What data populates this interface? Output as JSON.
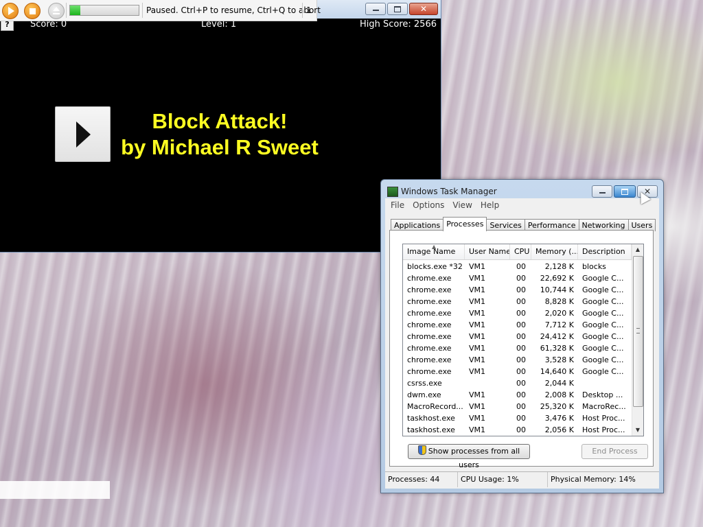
{
  "macro_bar": {
    "status_text": "Paused. Ctrl+P to resume, Ctrl+Q to abort",
    "counter": "1",
    "progress_percent": 15
  },
  "game": {
    "help_label": "?",
    "score_label": "Score: 0",
    "level_label": "Level: 1",
    "high_score_label": "High Score: 2566",
    "title_line1": "Block Attack!",
    "title_line2": "by Michael R Sweet",
    "title_color": "#ffff22"
  },
  "task_manager": {
    "title": "Windows Task Manager",
    "menu": [
      "File",
      "Options",
      "View",
      "Help"
    ],
    "tabs": [
      "Applications",
      "Processes",
      "Services",
      "Performance",
      "Networking",
      "Users"
    ],
    "active_tab": "Processes",
    "columns": [
      "Image Name",
      "User Name",
      "CPU",
      "Memory (...",
      "Description"
    ],
    "rows": [
      [
        "blocks.exe *32",
        "VM1",
        "00",
        "2,128 K",
        "blocks"
      ],
      [
        "chrome.exe",
        "VM1",
        "00",
        "22,692 K",
        "Google C..."
      ],
      [
        "chrome.exe",
        "VM1",
        "00",
        "10,744 K",
        "Google C..."
      ],
      [
        "chrome.exe",
        "VM1",
        "00",
        "8,828 K",
        "Google C..."
      ],
      [
        "chrome.exe",
        "VM1",
        "00",
        "2,020 K",
        "Google C..."
      ],
      [
        "chrome.exe",
        "VM1",
        "00",
        "7,712 K",
        "Google C..."
      ],
      [
        "chrome.exe",
        "VM1",
        "00",
        "24,412 K",
        "Google C..."
      ],
      [
        "chrome.exe",
        "VM1",
        "00",
        "61,328 K",
        "Google C..."
      ],
      [
        "chrome.exe",
        "VM1",
        "00",
        "3,528 K",
        "Google C..."
      ],
      [
        "chrome.exe",
        "VM1",
        "00",
        "14,640 K",
        "Google C..."
      ],
      [
        "csrss.exe",
        "",
        "00",
        "2,044 K",
        ""
      ],
      [
        "dwm.exe",
        "VM1",
        "00",
        "2,008 K",
        "Desktop ..."
      ],
      [
        "MacroRecord...",
        "VM1",
        "00",
        "25,320 K",
        "MacroRec..."
      ],
      [
        "taskhost.exe",
        "VM1",
        "00",
        "3,476 K",
        "Host Proc..."
      ],
      [
        "taskhost.exe",
        "VM1",
        "00",
        "2,056 K",
        "Host Proc..."
      ]
    ],
    "show_all_button": "Show processes from all users",
    "end_process_button": "End Process",
    "status": {
      "processes": "Processes: 44",
      "cpu": "CPU Usage: 1%",
      "memory": "Physical Memory: 14%"
    }
  }
}
